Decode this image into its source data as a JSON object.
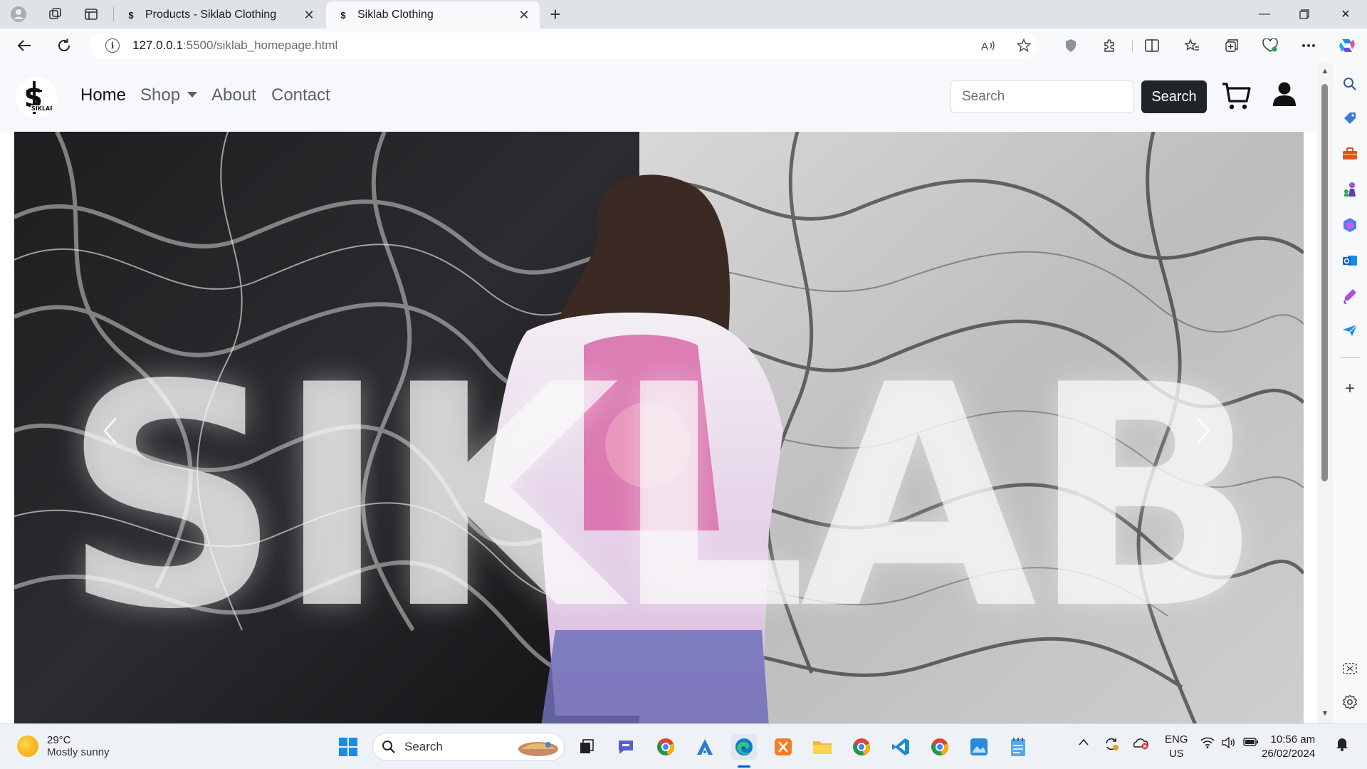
{
  "browser": {
    "tabs": [
      {
        "title": "Products - Siklab Clothing",
        "active": false
      },
      {
        "title": "Siklab Clothing",
        "active": true
      }
    ],
    "url_host": "127.0.0.1",
    "url_path": ":5500/siklab_homepage.html"
  },
  "page": {
    "nav": {
      "home": "Home",
      "shop": "Shop",
      "about": "About",
      "contact": "Contact"
    },
    "search": {
      "placeholder": "Search",
      "button": "Search"
    },
    "hero": {
      "brand_text": "SIKLAB"
    }
  },
  "taskbar": {
    "weather_temp": "29°C",
    "weather_desc": "Mostly sunny",
    "search_label": "Search",
    "lang_line1": "ENG",
    "lang_line2": "US",
    "time": "10:56 am",
    "date": "26/02/2024"
  },
  "colors": {
    "navbar_bg": "#f6f8fb",
    "search_button_bg": "#212529",
    "accent_edge": "#0b57d0"
  }
}
